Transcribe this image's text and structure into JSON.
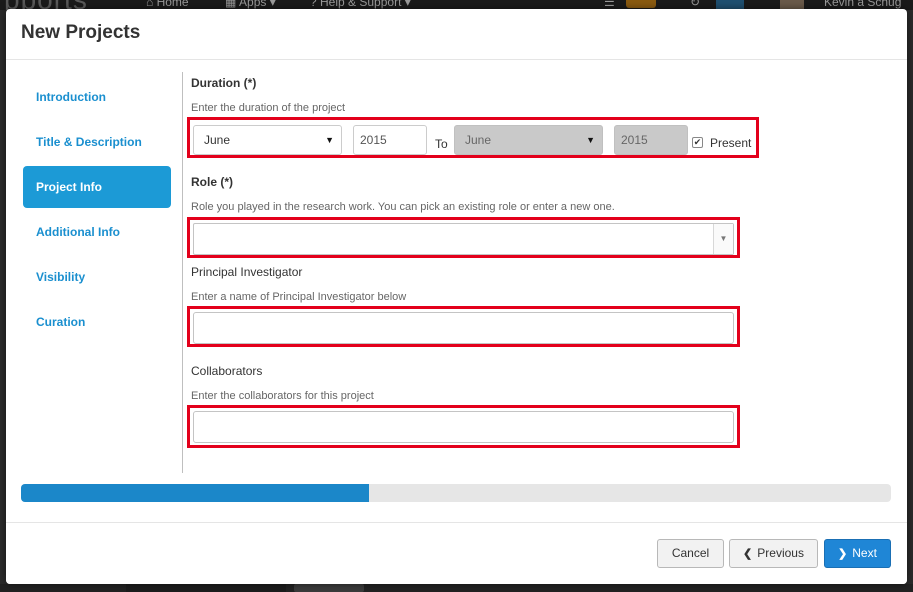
{
  "background": {
    "nav_items": [
      "Home",
      "Apps",
      "Help & Support"
    ],
    "user_name": "Kevin a Schug"
  },
  "modal": {
    "title": "New Projects"
  },
  "sidebar": {
    "items": [
      {
        "label": "Introduction",
        "active": false
      },
      {
        "label": "Title & Description",
        "active": false
      },
      {
        "label": "Project Info",
        "active": true
      },
      {
        "label": "Additional Info",
        "active": false
      },
      {
        "label": "Visibility",
        "active": false
      },
      {
        "label": "Curation",
        "active": false
      }
    ]
  },
  "duration": {
    "label": "Duration (*)",
    "help": "Enter the duration of the project",
    "start_month": "June",
    "start_year": "2015",
    "to_label": "To",
    "end_month": "June",
    "end_year": "2015",
    "present_label": "Present",
    "present_checked": true
  },
  "role": {
    "label": "Role (*)",
    "help": "Role you played in the research work. You can pick an existing role or enter a new one.",
    "value": ""
  },
  "principal_investigator": {
    "label": "Principal Investigator",
    "help": "Enter a name of Principal Investigator below",
    "value": ""
  },
  "collaborators": {
    "label": "Collaborators",
    "help": "Enter the collaborators for this project",
    "value": ""
  },
  "progress": {
    "fraction": 0.4,
    "fill_color": "#1b87c9"
  },
  "footer": {
    "cancel_label": "Cancel",
    "previous_label": "Previous",
    "next_label": "Next"
  },
  "colors": {
    "accent": "#1c9ad6",
    "link": "#1a8fcf",
    "highlight": "#e3001b",
    "primary_button": "#1f86d6"
  }
}
